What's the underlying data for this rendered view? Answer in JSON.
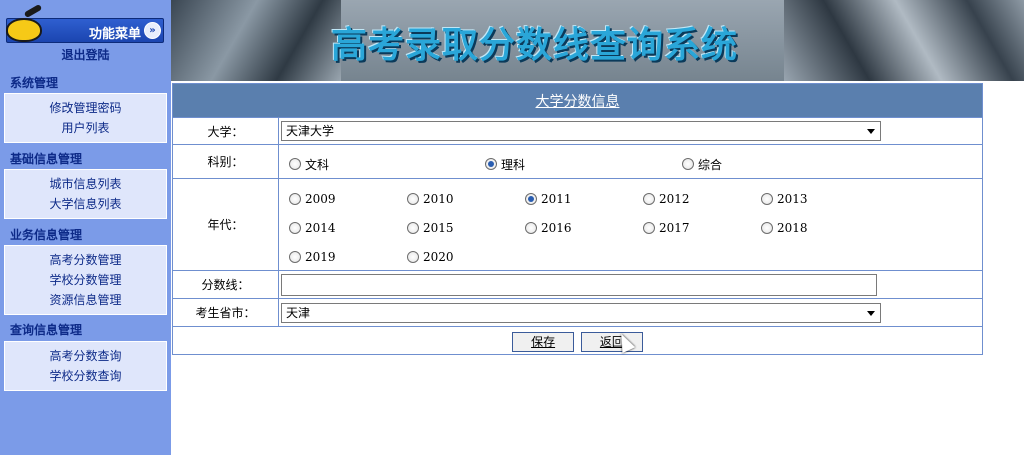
{
  "sidebar": {
    "menu_title": "功能菜单",
    "toggle_icon": "double-chevron-down-icon",
    "logo_icon": "yellow-mascot-icon",
    "logout": "退出登陆",
    "sections": [
      {
        "title": "系统管理",
        "items": [
          "修改管理密码",
          "用户列表"
        ]
      },
      {
        "title": "基础信息管理",
        "items": [
          "城市信息列表",
          "大学信息列表"
        ]
      },
      {
        "title": "业务信息管理",
        "items": [
          "高考分数管理",
          "学校分数管理",
          "资源信息管理"
        ]
      },
      {
        "title": "查询信息管理",
        "items": [
          "高考分数查询",
          "学校分数查询"
        ]
      }
    ]
  },
  "banner": {
    "title": "高考录取分数线查询系统"
  },
  "form": {
    "caption": "大学分数信息",
    "university": {
      "label": "大学：",
      "value": "天津大学"
    },
    "category": {
      "label": "科别：",
      "options": [
        "文科",
        "理科",
        "综合"
      ],
      "selected": "理科"
    },
    "year": {
      "label": "年代：",
      "options": [
        "2009",
        "2010",
        "2011",
        "2012",
        "2013",
        "2014",
        "2015",
        "2016",
        "2017",
        "2018",
        "2019",
        "2020"
      ],
      "selected": "2011"
    },
    "score": {
      "label": "分数线：",
      "value": ""
    },
    "province": {
      "label": "考生省市：",
      "value": "天津"
    },
    "save_label": "保存",
    "back_label": "返回"
  },
  "colors": {
    "sidebar_bg": "#7b9be8",
    "section_text": "#0d2a88",
    "header_bar": "#5a7fae",
    "banner_title": "#2aa6d8"
  }
}
